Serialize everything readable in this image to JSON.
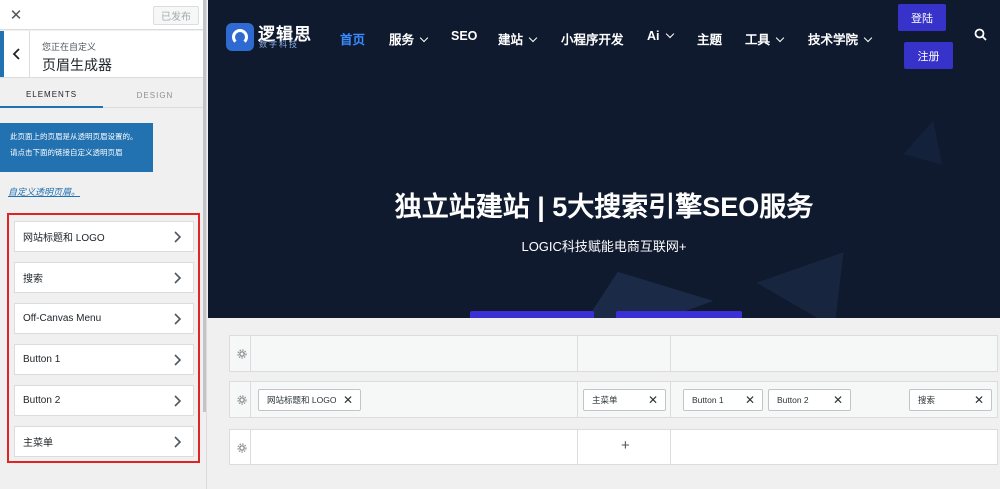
{
  "sidebar": {
    "close_glyph": "✕",
    "publish_label": "已发布",
    "header_small": "您正在自定义",
    "header_title": "页眉生成器",
    "tabs": [
      {
        "label": "ELEMENTS"
      },
      {
        "label": "DESIGN"
      }
    ],
    "notice_line1": "此页面上的页眉是从透明页眉设置的。",
    "notice_line2": "请点击下面的链接自定义透明页眉",
    "custom_link": "自定义透明页眉。",
    "items": [
      {
        "label": "网站标题和 LOGO"
      },
      {
        "label": "搜索"
      },
      {
        "label": "Off-Canvas Menu"
      },
      {
        "label": "Button 1"
      },
      {
        "label": "Button 2"
      },
      {
        "label": "主菜单"
      }
    ]
  },
  "site": {
    "logo_title": "逻辑思",
    "logo_subtitle": "数字科技",
    "nav": [
      {
        "label": "首页",
        "active": true,
        "dropdown": false
      },
      {
        "label": "服务",
        "dropdown": true
      },
      {
        "label": "SEO",
        "dropdown": false
      },
      {
        "label": "建站",
        "dropdown": true
      },
      {
        "label": "小程序开发",
        "dropdown": false
      },
      {
        "label": "Ai",
        "dropdown": true
      },
      {
        "label": "主题",
        "dropdown": false
      },
      {
        "label": "工具",
        "dropdown": true
      },
      {
        "label": "技术学院",
        "dropdown": true
      }
    ],
    "login_label": "登陆",
    "register_label": "注册",
    "hero_title": "独立站建站 | 5大搜索引擎SEO服务",
    "hero_subtitle": "LOGIC科技赋能电商互联网+",
    "accent_color": "#3732c9",
    "active_nav_color": "#3b8cff"
  },
  "builder": {
    "main_row": {
      "left": [
        {
          "label": "网站标题和 LOGO"
        }
      ],
      "center": [
        {
          "label": "主菜单"
        }
      ],
      "right": [
        {
          "label": "Button 1"
        },
        {
          "label": "Button 2"
        },
        {
          "label": "搜索"
        }
      ]
    },
    "remove_glyph": "✕",
    "add_glyph": "+"
  }
}
